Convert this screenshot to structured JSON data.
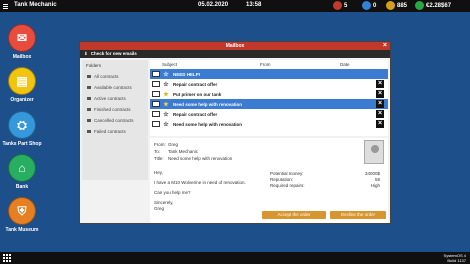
{
  "topbar": {
    "app_title": "Tank Mechanic",
    "date": "05.02.2020",
    "time": "13:58",
    "stats": [
      {
        "name": "stat-1",
        "value": "5",
        "color": "#c0392b"
      },
      {
        "name": "stat-2",
        "value": "0",
        "color": "#2f84d6"
      },
      {
        "name": "stat-3",
        "value": "885",
        "color": "#d4a017"
      },
      {
        "name": "stat-4",
        "value": "€2.28$67",
        "color": "#27a844"
      }
    ]
  },
  "desktop": {
    "icons": [
      {
        "label": "Mailbox",
        "icon": "mail-icon",
        "color": "#e74c3c"
      },
      {
        "label": "Organizer",
        "icon": "organizer-icon",
        "color": "#f1c40f"
      },
      {
        "label": "Tanks Part Shop",
        "icon": "tank-shop-icon",
        "color": "#3498db"
      },
      {
        "label": "Bank",
        "icon": "bank-icon",
        "color": "#27ae60"
      },
      {
        "label": "Tank Museum",
        "icon": "museum-icon",
        "color": "#e67e22"
      }
    ]
  },
  "mailbox": {
    "title": "Mailbox",
    "toolbar_label": "Check for new emails",
    "sidebar": {
      "header": "Folders",
      "items": [
        "All contracts",
        "Available contracts",
        "Active contracts",
        "Finished contracts",
        "Cancelled contracts",
        "Failed contracts"
      ]
    },
    "columns": [
      "Subject",
      "From",
      "Date"
    ],
    "emails": [
      {
        "subject": "NEED HELP!",
        "selected": true,
        "starred": false
      },
      {
        "subject": "Repair contract offer",
        "selected": false,
        "starred": false
      },
      {
        "subject": "Put primer on our tank",
        "selected": false,
        "starred": true
      },
      {
        "subject": "Need some help with renovation",
        "selected": true,
        "starred": true
      },
      {
        "subject": "Repair contract offer",
        "selected": false,
        "starred": false
      },
      {
        "subject": "Need some help with renovation",
        "selected": false,
        "starred": false
      }
    ],
    "preview": {
      "from_label": "From:",
      "from": "Greg",
      "to_label": "To:",
      "to": "Tank Mechanic",
      "title_label": "Title:",
      "title": "Need some help with renovation",
      "body": [
        "Hey,",
        "I have a M10 Wolverine in need of renovation.",
        "Can you help me?",
        "Sincerely,",
        "Greg"
      ],
      "potential_money_label": "Potential money:",
      "potential_money": "34000$",
      "reputation_label": "Reputation:",
      "reputation": "59",
      "required_repairs_label": "Required repairs:",
      "required_repairs": "High",
      "accept_label": "Accept the order",
      "decline_label": "Decline the order"
    }
  },
  "bottombar": {
    "build_line1": "SystemOS 4",
    "build_line2": "Build 1137"
  }
}
